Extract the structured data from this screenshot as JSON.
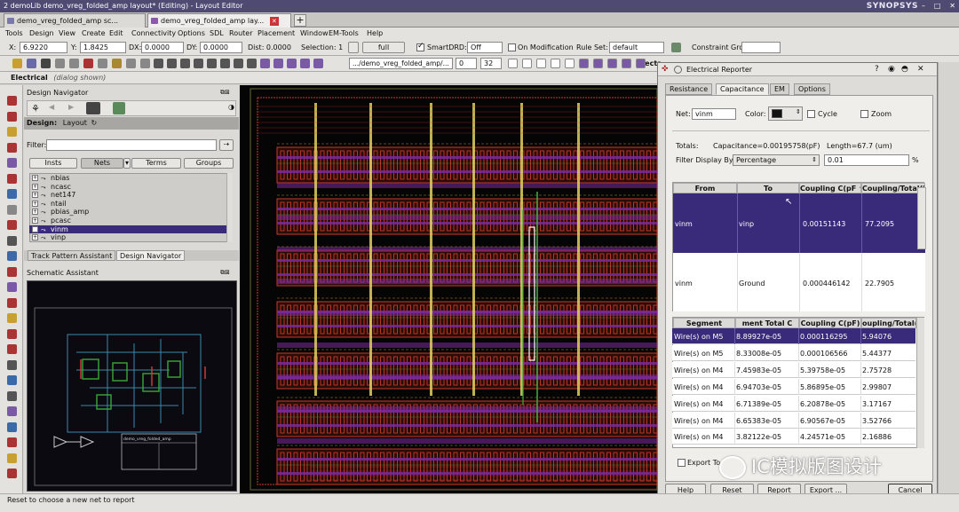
{
  "window": {
    "title": "2 demoLib demo_vreg_folded_amp layout* (Editing) - Layout Editor",
    "brand": "SYNOPSYS"
  },
  "tabs": [
    {
      "label": "demo_vreg_folded_amp sc..."
    },
    {
      "label": "demo_vreg_folded_amp lay..."
    }
  ],
  "menus": [
    "Tools",
    "Design",
    "View",
    "Create",
    "Edit",
    "Connectivity",
    "Options",
    "SDL",
    "Router",
    "Placement",
    "Window",
    "EM-Tools",
    "Help"
  ],
  "coordbar": {
    "x_label": "X:",
    "x_value": "6.9220",
    "y_label": "Y:",
    "y_value": "1.8425",
    "dx_label": "DX:",
    "dx_value": "0.0000",
    "dy_label": "DY:",
    "dy_value": "0.0000",
    "dist_label": "Dist: 0.0000",
    "selection_label": "Selection: 1",
    "full_label": "full",
    "smartdrd_label": "SmartDRD:",
    "smartdrd_value": "Off",
    "onmod_label": "On Modification",
    "ruleset_label": "Rule Set:",
    "ruleset_value": "default",
    "constraint_label": "Constraint Group:"
  },
  "iconbar": {
    "path_value": ".../demo_vreg_folded_amp/...",
    "level_from": "0",
    "level_to": "32",
    "rect_hint": "Recta..."
  },
  "statusstrip": {
    "mode": "Electrical",
    "note": "(dialog shown)"
  },
  "navigator": {
    "title": "Design Navigator",
    "design_label": "Design:",
    "design_value": "Layout",
    "filter_label": "Filter:",
    "tabs": [
      "Insts",
      "Nets",
      "Terms",
      "Groups"
    ],
    "nets": [
      "nbias",
      "ncasc",
      "net147",
      "ntail",
      "pbias_amp",
      "pcasc",
      "vinm",
      "vinp"
    ],
    "selected_net": "vinm",
    "bottom_tabs": [
      "Track Pattern Assistant",
      "Design Navigator"
    ]
  },
  "schematic": {
    "title": "Schematic Assistant",
    "titleblock_name": "demo_vreg_folded_amp"
  },
  "reporter": {
    "title": "Electrical Reporter",
    "tabs": [
      "Resistance",
      "Capacitance",
      "EM",
      "Options"
    ],
    "active_tab": "Capacitance",
    "net_label": "Net:",
    "net_value": "vinm",
    "color_label": "Color:",
    "cycle_label": "Cycle",
    "zoom_label": "Zoom",
    "totals_label": "Totals:",
    "totals_cap": "Capacitance=0.00195758(pF)",
    "totals_len": "Length=67.7 (um)",
    "filter_label": "Filter Display By",
    "filter_mode": "Percentage",
    "filter_value": "0.01",
    "filter_unit": "%",
    "coupling_table": {
      "headers": [
        "From",
        "To",
        "Coupling C(pF ^",
        "Coupling/Total(%"
      ],
      "rows": [
        {
          "from": "vinm",
          "to": "vinp",
          "cpf": "0.00151143",
          "pct": "77.2095"
        },
        {
          "from": "vinm",
          "to": "Ground",
          "cpf": "0.000446142",
          "pct": "22.7905"
        }
      ]
    },
    "segment_table": {
      "headers": [
        "Segment",
        "ment Total C",
        "Coupling C(pF)",
        "oupling/Total(%"
      ],
      "rows": [
        {
          "seg": "Wire(s) on M5",
          "total": "8.89927e-05",
          "cpf": "0.000116295",
          "pct": "5.94076"
        },
        {
          "seg": "Wire(s) on M5",
          "total": "8.33008e-05",
          "cpf": "0.000106566",
          "pct": "5.44377"
        },
        {
          "seg": "Wire(s) on M4",
          "total": "7.45983e-05",
          "cpf": "5.39758e-05",
          "pct": "2.75728"
        },
        {
          "seg": "Wire(s) on M4",
          "total": "6.94703e-05",
          "cpf": "5.86895e-05",
          "pct": "2.99807"
        },
        {
          "seg": "Wire(s) on M4",
          "total": "6.71389e-05",
          "cpf": "6.20878e-05",
          "pct": "3.17167"
        },
        {
          "seg": "Wire(s) on M4",
          "total": "6.65383e-05",
          "cpf": "6.90567e-05",
          "pct": "3.52766"
        },
        {
          "seg": "Wire(s) on M4",
          "total": "3.82122e-05",
          "cpf": "4.24571e-05",
          "pct": "2.16886"
        }
      ]
    },
    "export_label": "Export To",
    "buttons": {
      "help": "Help",
      "reset": "Reset",
      "report": "Report",
      "export": "Export ...",
      "cancel": "Cancel"
    }
  },
  "statusbar": {
    "message": "Reset to choose a new net to report"
  },
  "watermark": "IC模拟版图设计",
  "colors": {
    "selection": "#3a2a7a",
    "titlebar": "#4e4a72",
    "layout_red": "#c83a2a",
    "layout_purple": "#7a2aa0",
    "layout_yellow": "#e0d060",
    "layout_green": "#3aa83a"
  }
}
